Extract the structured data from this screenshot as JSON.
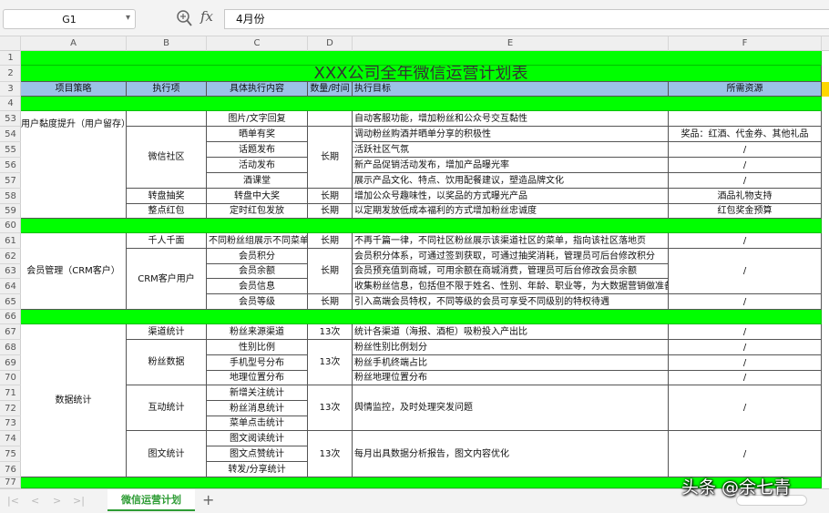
{
  "formula_bar": {
    "cell_ref": "G1",
    "fx_label": "fx",
    "content": "4月份"
  },
  "columns": [
    "A",
    "B",
    "C",
    "D",
    "E",
    "F"
  ],
  "rows": [
    "1",
    "2",
    "3",
    "4",
    "53",
    "54",
    "55",
    "56",
    "57",
    "58",
    "59",
    "60",
    "61",
    "62",
    "63",
    "64",
    "65",
    "66",
    "67",
    "68",
    "69",
    "70",
    "71",
    "72",
    "73",
    "74",
    "75",
    "76",
    "77"
  ],
  "sheet": {
    "title": "XXX公司全年微信运营计划表",
    "headers": [
      "项目策略",
      "执行项",
      "具体执行内容",
      "数量/时间",
      "执行目标",
      "所需资源"
    ],
    "cells": {
      "a_user": "用户黏度提升（用户留存）",
      "a_crm": "会员管理（CRM客户）",
      "a_data": "数据统计",
      "b_wx": "微信社区",
      "b_zp": "转盘抽奖",
      "b_hb": "整点红包",
      "b_qr": "千人千面",
      "b_crm": "CRM客户用户",
      "b_qd": "渠道统计",
      "b_fs": "粉丝数据",
      "b_hd": "互动统计",
      "b_tw": "图文统计",
      "c53": "图片/文字回复",
      "c54": "晒单有奖",
      "c55": "话题发布",
      "c56": "活动发布",
      "c57": "酒课堂",
      "c58": "转盘中大奖",
      "c59": "定时红包发放",
      "c61": "不同粉丝组展示不同菜单",
      "c62": "会员积分",
      "c63": "会员余额",
      "c64": "会员信息",
      "c65": "会员等级",
      "c67": "粉丝来源渠道",
      "c68": "性别比例",
      "c69": "手机型号分布",
      "c70": "地理位置分布",
      "c71": "新增关注统计",
      "c72": "粉丝消息统计",
      "c73": "菜单点击统计",
      "c74": "图文阅读统计",
      "c75": "图文点赞统计",
      "c76": "转发/分享统计",
      "d_long": "长期",
      "d_13": "13次",
      "e53": "自动客服功能，增加粉丝和公众号交互黏性",
      "e54": "调动粉丝购酒并晒单分享的积极性",
      "e55": "活跃社区气氛",
      "e56": "新产品促销活动发布，增加产品曝光率",
      "e57": "展示产品文化、特点、饮用配餐建议，塑造品牌文化",
      "e58": "增加公众号趣味性，以奖品的方式曝光产品",
      "e59": "以定期发放低成本福利的方式增加粉丝忠诚度",
      "e61": "不再千篇一律，不同社区粉丝展示该渠道社区的菜单，指向该社区落地页",
      "e62": "会员积分体系，可通过签到获取，可通过抽奖消耗，管理员可后台修改积分",
      "e63": "会员预充值到商城，可用余额在商城消费，管理员可后台修改会员余额",
      "e64": "收集粉丝信息，包括但不限于姓名、性别、年龄、职业等，为大数据营销做准备",
      "e65": "引入高端会员特权，不同等级的会员可享受不同级别的特权待遇",
      "e67": "统计各渠道（海报、酒柜）吸粉投入产出比",
      "e68": "粉丝性别比例划分",
      "e69": "粉丝手机终端占比",
      "e70": "粉丝地理位置分布",
      "e_hd": "舆情监控，及时处理突发问题",
      "e_tw": "每月出具数据分析报告，图文内容优化",
      "f54": "奖品：红酒、代金券、其他礼品",
      "f58": "酒品礼物支持",
      "f59": "红包奖金预算",
      "slash": "/"
    }
  },
  "tabs": {
    "active": "微信运营计划",
    "add_label": "+"
  },
  "nav_arrows": [
    "|<",
    "<",
    ">",
    ">|"
  ],
  "watermark": "头条 @余七青"
}
